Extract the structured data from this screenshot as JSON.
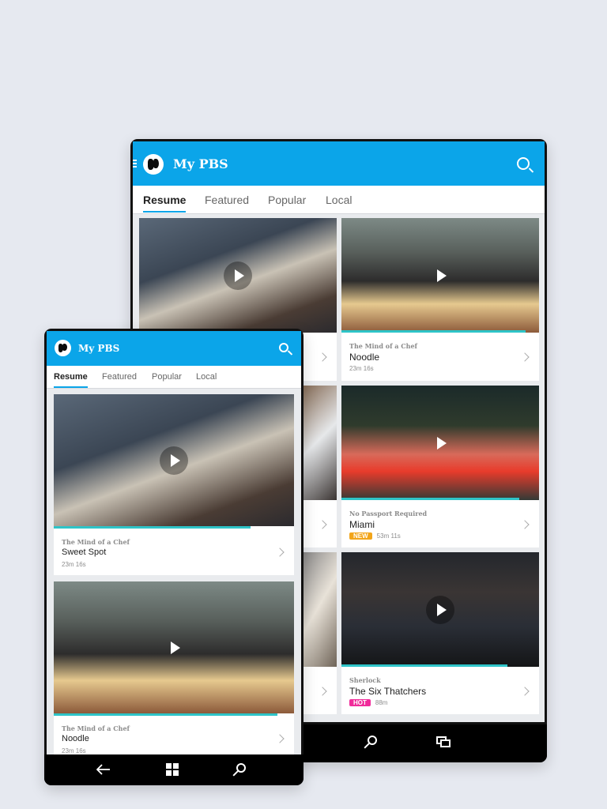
{
  "app": {
    "title": "My PBS"
  },
  "tabs": [
    "Resume",
    "Featured",
    "Popular",
    "Local"
  ],
  "colors": {
    "brand": "#0ba5e9",
    "progress": "#2ec4c8",
    "new_badge": "#f2a51a",
    "hot_badge": "#f02b9a"
  },
  "icons": {
    "menu": "hamburger-icon",
    "logo": "pbs-logo-icon",
    "search": "search-icon",
    "play": "play-icon",
    "chevron": "chevron-right-icon",
    "back": "back-arrow-icon",
    "windows": "windows-start-icon",
    "nav_search": "search-icon",
    "task_view": "task-view-icon"
  },
  "videos": [
    {
      "show": "The Mind of a Chef",
      "title": "Sweet Spot",
      "duration": "23m 16s",
      "badge": "",
      "progress": 0.82
    },
    {
      "show": "The Mind of a Chef",
      "title": "Noodle",
      "duration": "23m 16s",
      "badge": "",
      "progress": 0.93
    },
    {
      "show": "No Passport Required",
      "title": "Miami",
      "duration": "53m 11s",
      "badge": "NEW",
      "progress": 0.9
    },
    {
      "show": "Sherlock",
      "title": "The Six Thatchers",
      "duration": "88m",
      "badge": "HOT",
      "progress": 0.84
    }
  ]
}
